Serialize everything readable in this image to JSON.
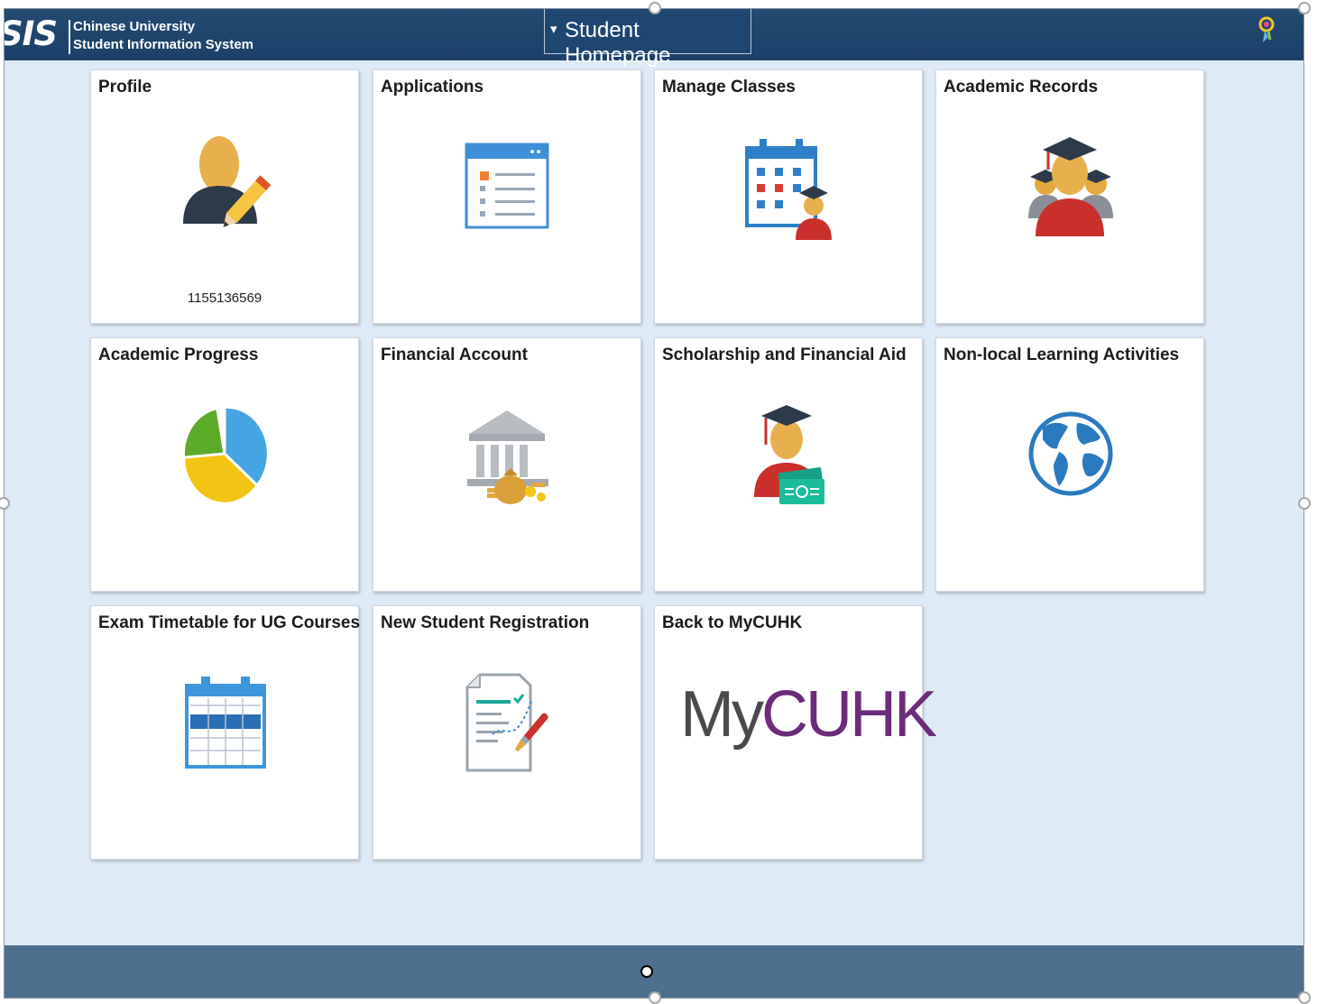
{
  "header": {
    "logo": "SIS",
    "org_line1": "Chinese University",
    "org_line2": "Student Information System",
    "homepage_caret": "▾",
    "homepage_label": "Student Homepage",
    "nav_icon": "navbar-icon"
  },
  "tiles": [
    {
      "title": "Profile",
      "icon": "profile-edit-icon",
      "subtitle": "1155136569"
    },
    {
      "title": "Applications",
      "icon": "application-form-icon"
    },
    {
      "title": "Manage Classes",
      "icon": "class-calendar-icon"
    },
    {
      "title": "Academic Records",
      "icon": "graduates-icon"
    },
    {
      "title": "Academic Progress",
      "icon": "pie-chart-icon"
    },
    {
      "title": "Financial Account",
      "icon": "bank-money-icon"
    },
    {
      "title": "Scholarship and Financial Aid",
      "icon": "graduate-cash-icon"
    },
    {
      "title": "Non-local Learning Activities",
      "icon": "globe-icon"
    },
    {
      "title": "Exam Timetable for UG Courses",
      "icon": "timetable-icon"
    },
    {
      "title": "New Student Registration",
      "icon": "registration-form-icon"
    },
    {
      "title": "Back to MyCUHK",
      "logo_my": "My",
      "logo_cuhk": "CUHK"
    }
  ],
  "colors": {
    "header": "#1f4670",
    "background": "#deeaf6",
    "footer": "#4f6f8e",
    "mycuhk_my": "#4a4a4a",
    "mycuhk_cuhk": "#6b2c7a"
  }
}
